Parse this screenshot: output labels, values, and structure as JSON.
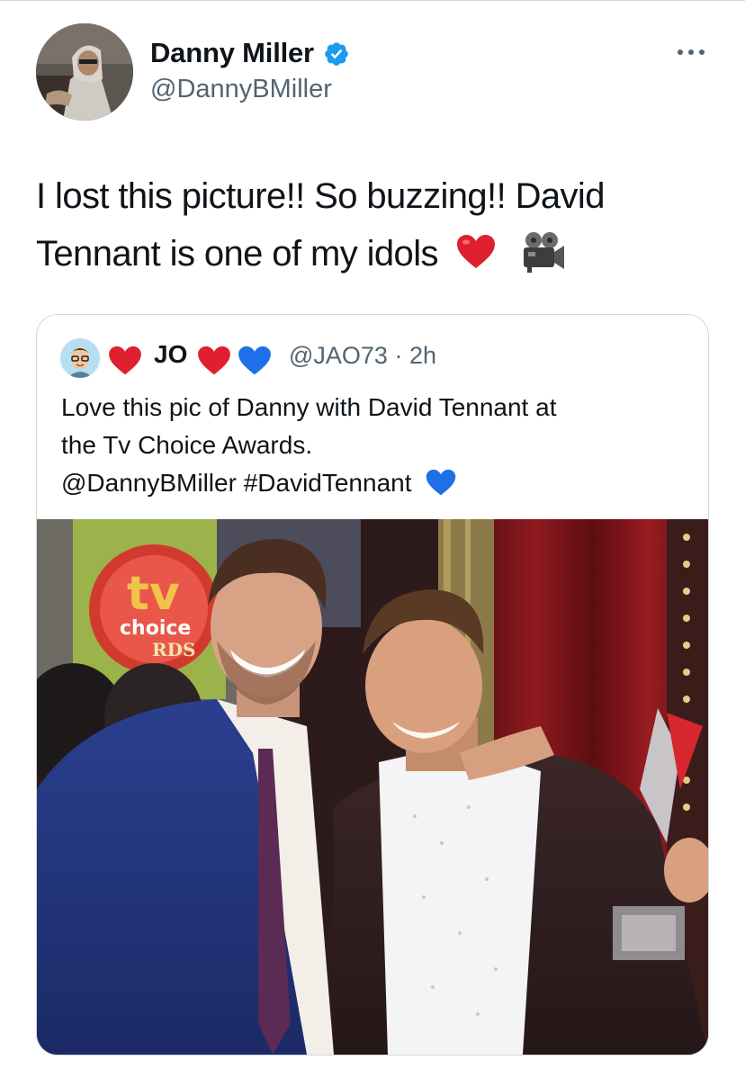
{
  "author": {
    "display_name": "Danny Miller",
    "handle": "@DannyBMiller",
    "verified": true
  },
  "tweet": {
    "line1": "I lost this picture!! So buzzing!! David",
    "line2": "Tennant is one of my idols",
    "emojis": [
      "red-heart",
      "movie-camera"
    ]
  },
  "quoted_tweet": {
    "name": "JO",
    "handle": "@JAO73",
    "separator": "·",
    "time": "2h",
    "name_emojis": [
      "red-heart",
      "red-heart",
      "blue-heart"
    ],
    "text_line1": "Love this pic of Danny with David Tennant at",
    "text_line2": "the Tv Choice Awards.",
    "text_line3": "@DannyBMiller #DavidTennant",
    "text_emoji": "blue-heart",
    "photo": {
      "sign_text_1": "tv",
      "sign_text_2": "choice",
      "sign_text_3": "RDS"
    }
  },
  "colors": {
    "text": "#0f1419",
    "secondary": "#536471",
    "verified_blue": "#1d9bf0",
    "border": "#cfd9de",
    "heart_red": "#e0202f",
    "heart_blue": "#1f6fe8"
  }
}
